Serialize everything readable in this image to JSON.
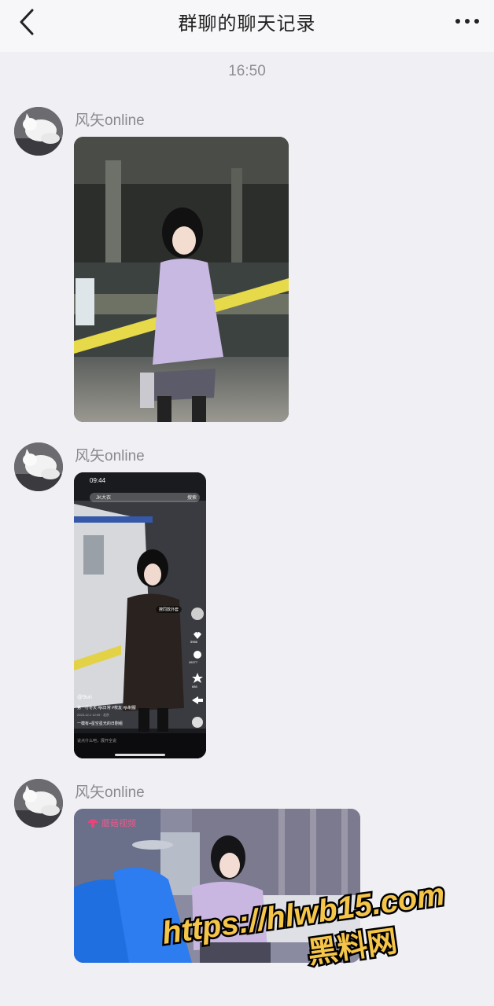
{
  "header": {
    "title": "群聊的聊天记录",
    "back_icon": "chevron-left-icon",
    "more_icon": "more-dots-icon"
  },
  "timestamp": "16:50",
  "messages": [
    {
      "sender": "风矢online",
      "image": "photo of girl in lavender cardigan on subway platform"
    },
    {
      "sender": "风矢online",
      "image": "short-video app screenshot",
      "screenshot": {
        "time": "09:44",
        "search_text": "JK大衣",
        "search_button": "搜索",
        "pill_label": "撩同款外套",
        "like_count": "5966",
        "comment_count": "45277",
        "share_count": "686",
        "author": "@9uri",
        "caption": "第一行冬天 #jk日常 #校友 #jk制服",
        "date_line": "2023-12-1 12:09 · 北京",
        "tag_line": "一模有+星空星光的日剧组",
        "comment_placeholder": "说点什么吧，展开全说"
      }
    },
    {
      "sender": "风矢online",
      "image": "photo of girl in bedroom with blue sofa",
      "logo_text": "蘑菇视频"
    }
  ],
  "watermark": {
    "url": "https://hlwb15.com",
    "name": "黑料网"
  },
  "colors": {
    "background": "#efeff4",
    "header_bg": "#f7f7f9",
    "watermark_fill": "#f5c54a",
    "watermark_stroke": "#000000"
  }
}
